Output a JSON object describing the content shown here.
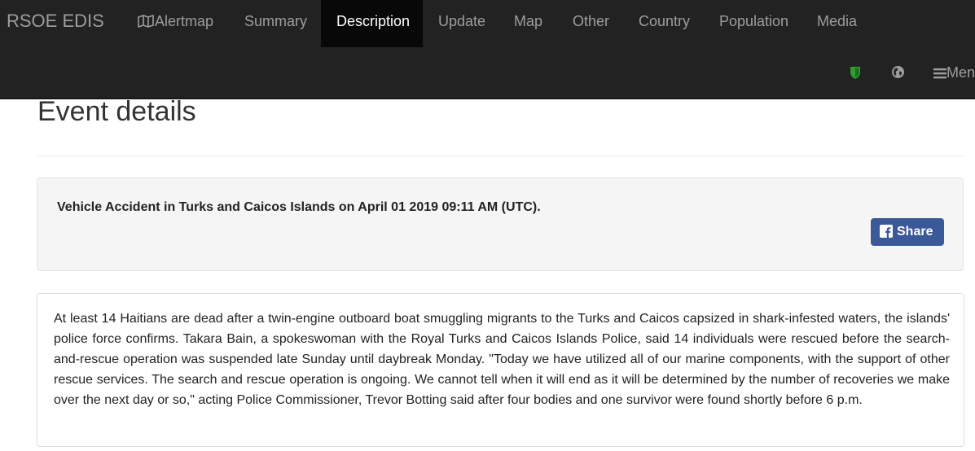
{
  "navbar": {
    "brand": "RSOE EDIS",
    "items": [
      {
        "label": "Alertmap",
        "icon": "map-icon"
      },
      {
        "label": "Summary"
      },
      {
        "label": "Description",
        "active": true
      },
      {
        "label": "Update"
      },
      {
        "label": "Map"
      },
      {
        "label": "Other"
      },
      {
        "label": "Country"
      },
      {
        "label": "Population"
      },
      {
        "label": "Media"
      }
    ],
    "icons": [
      "shield-icon",
      "globe-icon"
    ],
    "menu_label": "Menu",
    "background_color": "#222222",
    "active_color": "#080808",
    "shield_color": "#2e9d2e"
  },
  "page": {
    "heading": "Event details"
  },
  "event": {
    "title": "Vehicle Accident in Turks and Caicos Islands on April 01 2019 09:11 AM (UTC).",
    "share_label": "Share",
    "share_color": "#3b5998",
    "description": "At least 14 Haitians are dead after a twin-engine outboard boat smuggling migrants to the Turks and Caicos capsized in shark-infested waters, the islands' police force confirms. Takara Bain, a spokeswoman with the Royal Turks and Caicos Islands Police, said 14 individuals were rescued before the search-and-rescue operation was suspended late Sunday until daybreak Monday. \"Today we have utilized all of our marine components, with the support of other rescue services. The search and rescue operation is ongoing. We cannot tell when it will end as it will be determined by the number of recoveries we make over the next day or so,\" acting Police Commissioner, Trevor Botting said after four bodies and one survivor were found shortly before 6 p.m."
  }
}
